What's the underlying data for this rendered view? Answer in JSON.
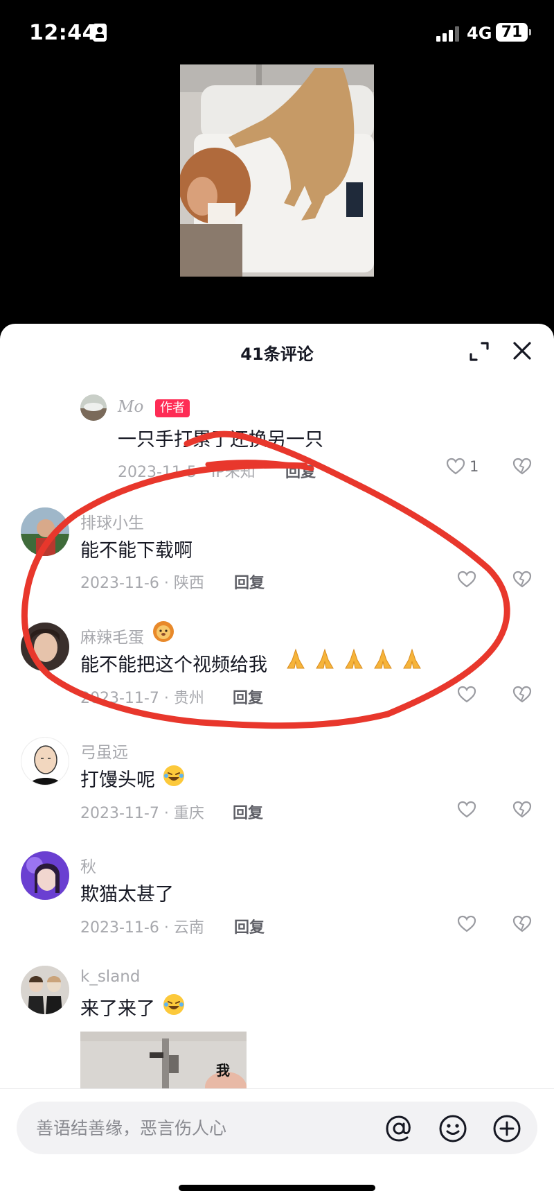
{
  "status_bar": {
    "time": "12:44",
    "network": "4G",
    "battery": "71"
  },
  "sheet": {
    "title": "41条评论"
  },
  "comments": [
    {
      "name": "Mo",
      "badge": "作者",
      "text": "一只手打累了还换另一只",
      "meta": "2023-11-5 · IP未知",
      "reply": "回复",
      "likes": "1"
    },
    {
      "name": "排球小生",
      "text": "能不能下载啊",
      "meta": "2023-11-6 · 陕西",
      "reply": "回复"
    },
    {
      "name": "麻辣毛蛋",
      "text": "能不能把这个视频给我",
      "meta": "2023-11-7 · 贵州",
      "reply": "回复"
    },
    {
      "name": "弓虽远",
      "text": "打馒头呢",
      "meta": "2023-11-7 · 重庆",
      "reply": "回复"
    },
    {
      "name": "秋",
      "text": "欺猫太甚了",
      "meta": "2023-11-6 · 云南",
      "reply": "回复"
    },
    {
      "name": "k_sland",
      "text": "来了来了",
      "image_caption": "我"
    }
  ],
  "input": {
    "placeholder": "善语结善缘，恶言伤人心"
  },
  "colors": {
    "accent": "#fe2c55",
    "annotation": "#e8372c",
    "secondary_text": "#a7a8ad"
  },
  "icons": [
    "expand-icon",
    "close-icon",
    "heart-icon",
    "broken-heart-icon",
    "at-icon",
    "smiley-icon",
    "plus-icon",
    "laughing-emoji-icon",
    "folded-hands-emoji-icon",
    "lion-emoji-icon"
  ]
}
